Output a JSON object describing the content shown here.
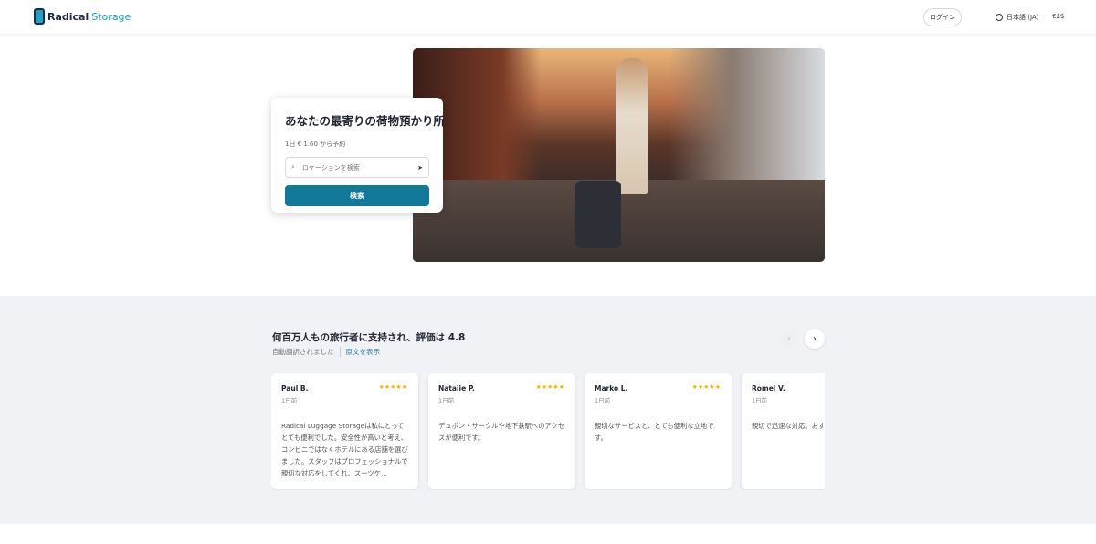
{
  "header": {
    "logo_part1": "Radical",
    "logo_part2": "Storage",
    "login": "ログイン",
    "language": "日本語 (JA)",
    "currency": "€£$"
  },
  "hero": {
    "title": "あなたの最寄りの荷物預かり所",
    "price_text": "1日 € 1.60 から予約",
    "search_placeholder": "ロケーションを検索",
    "search_button": "検索"
  },
  "reviews": {
    "title": "何百万人もの旅行者に支持され、評価は 4.8",
    "auto_translated": "自動翻訳されました",
    "show_original": "原文を表示",
    "prev": "‹",
    "next": "›",
    "items": [
      {
        "name": "Paul B.",
        "date": "1日前",
        "stars": "★★★★★",
        "rating": 5,
        "text": "Radical Luggage Storageは私にとってとても便利でした。安全性が高いと考え、コンビニではなくホテルにある店舗を選びました。スタッフはプロフェッショナルで親切な対応をしてくれ、スーツケ..."
      },
      {
        "name": "Natalie P.",
        "date": "1日前",
        "stars": "★★★★★",
        "rating": 5,
        "text": "デュポン・サークルや地下鉄駅へのアクセスが便利です。"
      },
      {
        "name": "Marko L.",
        "date": "1日前",
        "stars": "★★★★★",
        "rating": 5,
        "text": "親切なサービスと、とても便利な立地です。"
      },
      {
        "name": "Romel V.",
        "date": "1日前",
        "stars": "★★★★★",
        "rating": 5,
        "text": "親切で迅速な対応。おすすめです。"
      }
    ]
  },
  "colors": {
    "primary": "#13799a",
    "star": "#f5b400",
    "brand": "#1aa3c4"
  }
}
